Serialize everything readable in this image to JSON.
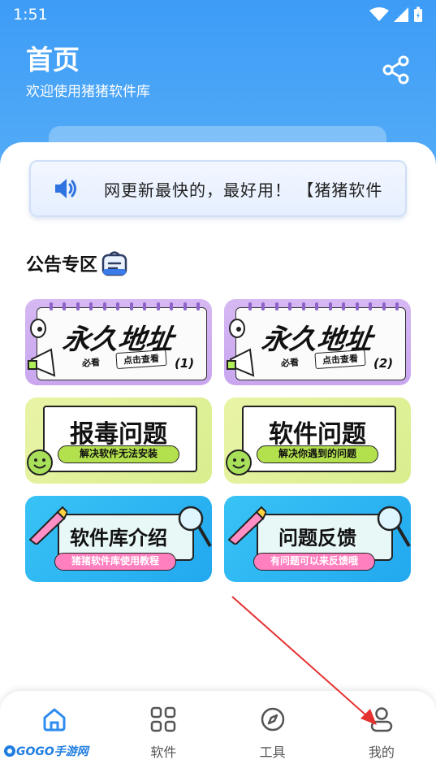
{
  "status_bar": {
    "time": "1:51"
  },
  "header": {
    "title": "首页",
    "subtitle": "欢迎使用猪猪软件库",
    "share_icon": "share-icon"
  },
  "notice": {
    "icon": "speaker-icon",
    "text": "网更新最快的，最好用！ 【猪猪软件"
  },
  "section": {
    "title": "公告专区",
    "icon": "badge-icon"
  },
  "cards": [
    {
      "title": "永久地址",
      "tag1": "必看",
      "tag2": "点击查看",
      "num": "(1)"
    },
    {
      "title": "永久地址",
      "tag1": "必看",
      "tag2": "点击查看",
      "num": "(2)"
    },
    {
      "title": "报毒问题",
      "desc": "解决软件无法安装"
    },
    {
      "title": "软件问题",
      "desc": "解决你遇到的问题"
    },
    {
      "title": "软件库介绍",
      "desc": "猪猪软件库使用教程"
    },
    {
      "title": "问题反馈",
      "desc": "有问题可以来反馈哦"
    }
  ],
  "tabbar": {
    "active": 0,
    "items": [
      {
        "label": "",
        "icon": "home-icon"
      },
      {
        "label": "软件",
        "icon": "grid-icon"
      },
      {
        "label": "工具",
        "icon": "compass-icon"
      },
      {
        "label": "我的",
        "icon": "user-icon"
      }
    ]
  },
  "watermark": {
    "text": "GOGO手游网"
  },
  "colors": {
    "primary": "#3d9cf7",
    "active_tab": "#2f8cf0",
    "arrow": "#e53030"
  }
}
